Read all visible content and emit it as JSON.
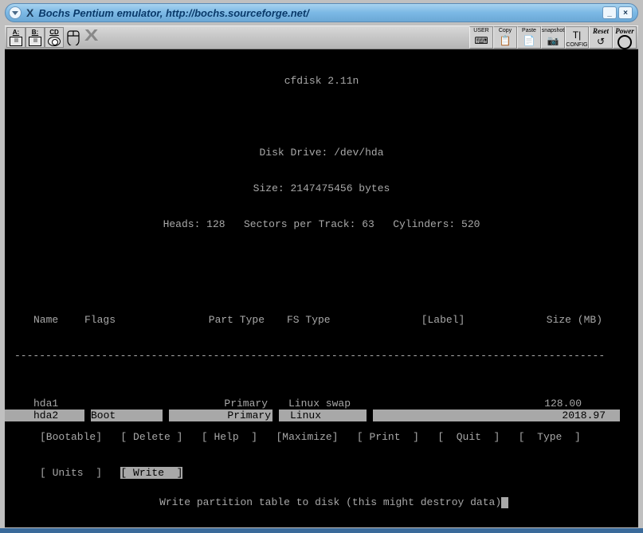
{
  "window": {
    "title": "Bochs Pentium emulator, http://bochs.sourceforge.net/"
  },
  "toolbar": {
    "drives": [
      "A:",
      "B:",
      "CD"
    ],
    "right": {
      "user": "USER",
      "copy": "Copy",
      "paste": "Paste",
      "snapshot": "snapshot",
      "config": "CONFIG",
      "reset": "Reset",
      "power": "Power"
    }
  },
  "cfdisk": {
    "title": "cfdisk 2.11n",
    "drive_label": "Disk Drive: /dev/hda",
    "size_label": "Size: 2147475456 bytes",
    "geometry": "Heads: 128   Sectors per Track: 63   Cylinders: 520",
    "columns": {
      "name": "Name",
      "flags": "Flags",
      "part_type": "Part Type",
      "fs_type": "FS Type",
      "label": "[Label]",
      "size": "Size (MB)"
    },
    "partitions": [
      {
        "name": "hda1",
        "flags": "",
        "part_type": "Primary",
        "fs_type": "Linux swap",
        "label": "",
        "size": "128.00",
        "selected": false
      },
      {
        "name": "hda2",
        "flags": "Boot",
        "part_type": "Primary",
        "fs_type": "Linux",
        "label": "",
        "size": "2018.97",
        "selected": true
      }
    ],
    "menu": {
      "row1": [
        "Bootable",
        " Delete ",
        " Help  ",
        "Maximize",
        " Print  ",
        "  Quit  ",
        "  Type  "
      ],
      "row2": [
        " Units  ",
        " Write  "
      ],
      "selected": "Write"
    },
    "hint": "Write partition table to disk (this might destroy data)"
  }
}
